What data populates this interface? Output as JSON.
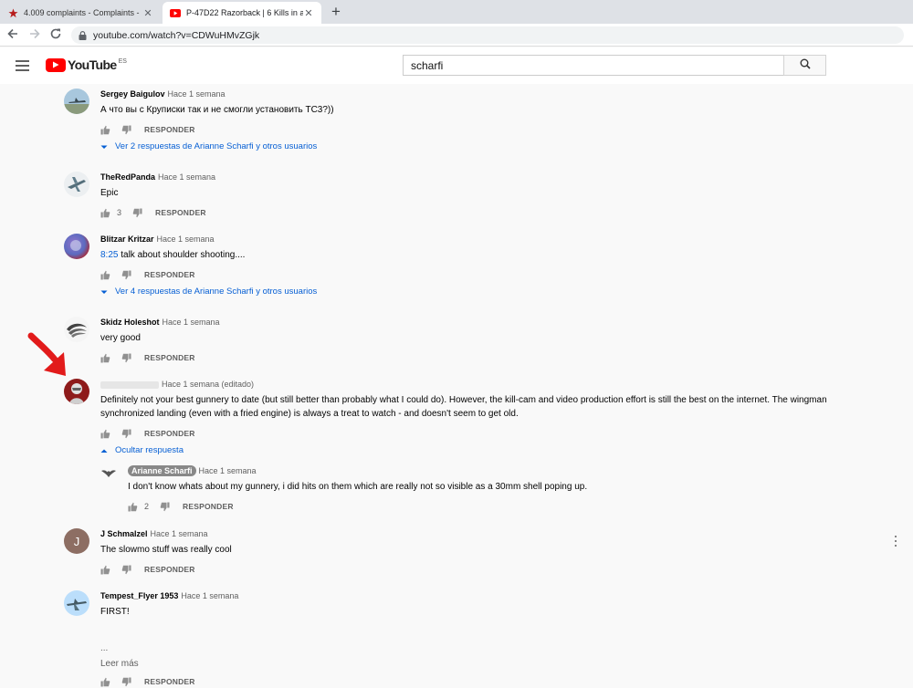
{
  "browser": {
    "tabs": [
      {
        "title": "4.009 complaints - Complaints - ",
        "icon": "star-icon",
        "active": false
      },
      {
        "title": "P-47D22 Razorback | 6 Kills in a ",
        "icon": "youtube-icon",
        "active": true
      }
    ],
    "new_tab": "+",
    "url_host": "youtube.com",
    "url_path": "/watch?v=CDWuHMvZGjk"
  },
  "youtube": {
    "logo_text": "YouTube",
    "region": "ES",
    "search_value": "scharfi"
  },
  "comments": [
    {
      "author": "Sergey Baigulov",
      "time": "Hace 1 semana",
      "text": "А что вы с Круписки так и не смогли установить TC3?))",
      "likes": "",
      "reply_label": "RESPONDER",
      "replies_toggle": "Ver 2 respuestas de Arianne Scharfi y otros usuarios"
    },
    {
      "author": "TheRedPanda",
      "time": "Hace 1 semana",
      "text": "Epic",
      "likes": "3",
      "reply_label": "RESPONDER"
    },
    {
      "author": "Blitzar Kritzar",
      "time": "Hace 1 semana",
      "timestamp_link": "8:25",
      "text": " talk about shoulder shooting....",
      "likes": "",
      "reply_label": "RESPONDER",
      "replies_toggle": "Ver 4 respuestas de Arianne Scharfi y otros usuarios"
    },
    {
      "author": "Skidz Holeshot",
      "time": "Hace 1 semana",
      "text": "very good",
      "likes": "",
      "reply_label": "RESPONDER"
    },
    {
      "author": "",
      "time": "Hace 1 semana (editado)",
      "text_line1": "Definitely not your best gunnery to date (but still better than probably what I could do).  However, the kill-cam and video production effort is still the best on the internet.  The wingman",
      "text_line2": "synchronized landing (even with a fried engine) is always a treat to watch - and doesn't seem to get old.",
      "likes": "",
      "reply_label": "RESPONDER",
      "replies_toggle": "Ocultar respuesta",
      "reply": {
        "author": "Arianne Scharfi",
        "time": "Hace 1 semana",
        "text": "I don't know whats about my gunnery, i did hits on them which are really not so visible as a 30mm shell poping up.",
        "likes": "2",
        "reply_label": "RESPONDER"
      }
    },
    {
      "author": "J Schmalzel",
      "avatar_letter": "J",
      "time": "Hace 1 semana",
      "text": "The slowmo stuff was really cool",
      "likes": "",
      "reply_label": "RESPONDER"
    },
    {
      "author": "Tempest_Flyer 1953",
      "time": "Hace 1 semana",
      "text": "FIRST!",
      "likes": "",
      "reply_label": "RESPONDER"
    }
  ],
  "read_more_ellipsis": "...",
  "read_more": "Leer más",
  "colors": {
    "link_blue": "#065fd4",
    "youtube_red": "#ff0000",
    "annotation_red": "#e21b1b",
    "author_chip": "#888888"
  }
}
